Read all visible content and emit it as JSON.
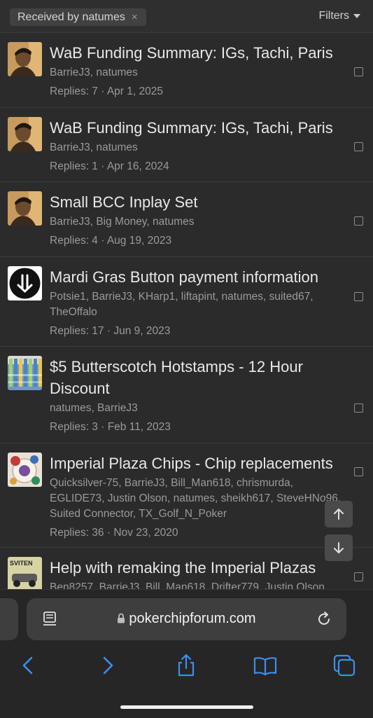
{
  "filter_bar": {
    "chip_label": "Received by natumes",
    "chip_close": "×",
    "filters_label": "Filters"
  },
  "threads": [
    {
      "title": "WaB Funding Summary: IGs, Tachi, Paris",
      "participants": "BarrieJ3, natumes",
      "meta": "Replies: 7 · Apr 1, 2025",
      "avatar": "portrait-avatar"
    },
    {
      "title": "WaB Funding Summary: IGs, Tachi, Paris",
      "participants": "BarrieJ3, natumes",
      "meta": "Replies: 1 · Apr 16, 2024",
      "avatar": "portrait-avatar"
    },
    {
      "title": "Small BCC Inplay Set",
      "participants": "BarrieJ3, Big Money, natumes",
      "meta": "Replies: 4 · Aug 19, 2023",
      "avatar": "portrait-avatar"
    },
    {
      "title": "Mardi Gras Button payment information",
      "participants": "Potsie1, BarrieJ3, KHarp1, liftapint, natumes, suited67, TheOffalo",
      "meta": "Replies: 17 · Jun 9, 2023",
      "avatar": "download-arrow-avatar"
    },
    {
      "title": "$5 Butterscotch Hotstamps - 12 Hour Discount",
      "participants": "natumes, BarrieJ3",
      "meta": "Replies: 3 · Feb 11, 2023",
      "avatar": "chip-stacks-avatar"
    },
    {
      "title": "Imperial Plaza Chips - Chip replacements",
      "participants": "Quicksilver-75, BarrieJ3, Bill_Man618, chrismurda, EGLIDE73, Justin Olson, natumes, sheikh617, SteveHNo96, Suited Connector, TX_Golf_N_Poker",
      "meta": "Replies: 36 · Nov 23, 2020",
      "avatar": "chip-plate-avatar"
    },
    {
      "title": "Help with remaking the Imperial Plazas",
      "participants": "Ben8257, BarrieJ3, Bill_Man618, Drifter779, Justin Olson,",
      "meta": "",
      "avatar": "sviten-car-avatar",
      "avatar_text": "SVITEN"
    }
  ],
  "scroll_buttons": {
    "up": "scroll-up-icon",
    "down": "scroll-down-icon"
  },
  "browser": {
    "url": "pokerchipforum.com",
    "toolbar_icons": [
      "back-icon",
      "forward-icon",
      "share-icon",
      "bookmarks-icon",
      "tabs-icon"
    ]
  },
  "colors": {
    "background": "#2b2b2b",
    "accent": "#3b8ff0",
    "text": "#e8e8e8",
    "muted": "#9a9a9a"
  }
}
